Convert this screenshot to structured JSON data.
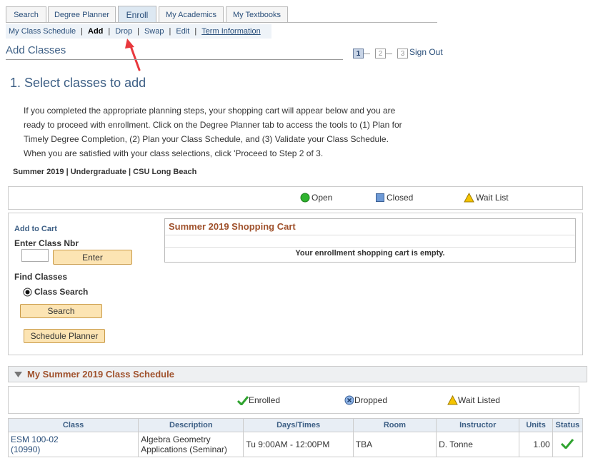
{
  "tabs": [
    {
      "label": "Search"
    },
    {
      "label": "Degree Planner"
    },
    {
      "label": "Enroll"
    },
    {
      "label": "My Academics"
    },
    {
      "label": "My Textbooks"
    }
  ],
  "subnav": {
    "my_class_schedule": "My Class Schedule",
    "add": "Add",
    "drop": "Drop",
    "swap": "Swap",
    "edit": "Edit",
    "term_information": "Term Information",
    "separator": "|"
  },
  "page": {
    "title": "Add Classes",
    "steps": [
      "1",
      "2",
      "3"
    ],
    "sign_out": "Sign Out",
    "heading": "1.  Select classes to add",
    "instructions": "If you completed the appropriate planning steps, your shopping cart will appear below and you are ready to proceed with enrollment. Click on the Degree Planner tab to access the tools to (1) Plan for Timely Degree Completion, (2) Plan your Class Schedule, and (3) Validate your Class Schedule. When you are satisfied with your class selections, click 'Proceed to Step 2 of 3.",
    "term_line": "Summer 2019 | Undergraduate | CSU Long Beach"
  },
  "legend": {
    "open": "Open",
    "closed": "Closed",
    "wait_list": "Wait List"
  },
  "add_to_cart": {
    "heading": "Add to Cart",
    "enter_class_nbr_label": "Enter Class Nbr",
    "class_nbr_value": "",
    "enter_button": "Enter",
    "find_classes_label": "Find Classes",
    "class_search_option": "Class Search",
    "search_button": "Search",
    "schedule_planner_button": "Schedule Planner"
  },
  "shopping_cart": {
    "title": "Summer 2019 Shopping Cart",
    "empty_message": "Your enrollment shopping cart is empty."
  },
  "schedule": {
    "title": "My Summer 2019 Class Schedule",
    "legend": {
      "enrolled": "Enrolled",
      "dropped": "Dropped",
      "wait_listed": "Wait Listed"
    },
    "columns": [
      "Class",
      "Description",
      "Days/Times",
      "Room",
      "Instructor",
      "Units",
      "Status"
    ],
    "rows": [
      {
        "class_line1": "ESM 100-02",
        "class_line2": "(10990)",
        "description": "Algebra Geometry Applications (Seminar)",
        "days_times": "Tu 9:00AM - 12:00PM",
        "room": "TBA",
        "instructor": "D. Tonne",
        "units": "1.00",
        "status_icon": "check-icon"
      }
    ]
  },
  "colors": {
    "link": "#2a4f7a",
    "heading_orange": "#a0522d",
    "button_bg": "#fce4b3",
    "open_green": "#2fb32f",
    "closed_blue": "#6e9ad6",
    "waitlist_yellow": "#f5c400",
    "annotation_arrow": "#e8383d"
  }
}
